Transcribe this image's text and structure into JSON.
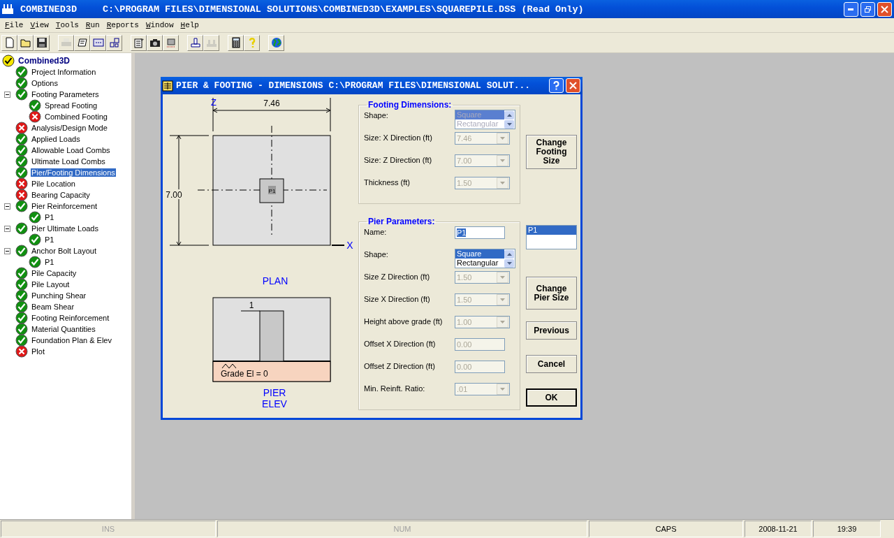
{
  "title_bar": {
    "app": "COMBINED3D",
    "document": "C:\\PROGRAM FILES\\DIMENSIONAL SOLUTIONS\\COMBINED3D\\EXAMPLES\\SQUAREPILE.DSS (Read Only)"
  },
  "menu": [
    "File",
    "View",
    "Tools",
    "Run",
    "Reports",
    "Window",
    "Help"
  ],
  "toolbar": [
    [
      {
        "kind": "page",
        "disabled": false
      },
      {
        "kind": "folder",
        "disabled": false
      },
      {
        "kind": "disk",
        "disabled": false
      }
    ],
    [
      {
        "kind": "printer",
        "disabled": true
      },
      {
        "kind": "scroll",
        "disabled": false
      },
      {
        "kind": "panel",
        "disabled": false
      },
      {
        "kind": "grid",
        "disabled": false
      }
    ],
    [
      {
        "kind": "clipboard",
        "disabled": false
      },
      {
        "kind": "camera",
        "disabled": false
      },
      {
        "kind": "chip",
        "disabled": false
      }
    ],
    [
      {
        "kind": "footing",
        "disabled": false
      },
      {
        "kind": "footings",
        "disabled": true
      }
    ],
    [
      {
        "kind": "calculator",
        "disabled": false
      },
      {
        "kind": "question",
        "disabled": false
      }
    ],
    [
      {
        "kind": "globe",
        "disabled": false
      }
    ]
  ],
  "tree": {
    "label": "Combined3D",
    "kind": "partial",
    "selected": false,
    "children": [
      {
        "label": "Project Information",
        "kind": "done",
        "selected": false
      },
      {
        "label": "Options",
        "kind": "done",
        "selected": false
      },
      {
        "label": "Footing Parameters",
        "kind": "done",
        "selected": false,
        "expanded": true,
        "children": [
          {
            "label": "Spread Footing",
            "kind": "done",
            "selected": false
          },
          {
            "label": "Combined Footing",
            "kind": "error",
            "selected": false
          }
        ]
      },
      {
        "label": "Analysis/Design Mode",
        "kind": "error",
        "selected": false
      },
      {
        "label": "Applied Loads",
        "kind": "done",
        "selected": false
      },
      {
        "label": "Allowable Load Combs",
        "kind": "done",
        "selected": false
      },
      {
        "label": "Ultimate Load Combs",
        "kind": "done",
        "selected": false
      },
      {
        "label": "Pier/Footing Dimensions",
        "kind": "done",
        "selected": true
      },
      {
        "label": "Pile Location",
        "kind": "error",
        "selected": false
      },
      {
        "label": "Bearing Capacity",
        "kind": "error",
        "selected": false
      },
      {
        "label": "Pier Reinforcement",
        "kind": "done",
        "selected": false,
        "expanded": true,
        "children": [
          {
            "label": "P1",
            "kind": "done",
            "selected": false
          }
        ]
      },
      {
        "label": "Pier Ultimate Loads",
        "kind": "done",
        "selected": false,
        "expanded": true,
        "children": [
          {
            "label": "P1",
            "kind": "done",
            "selected": false
          }
        ]
      },
      {
        "label": "Anchor Bolt Layout",
        "kind": "done",
        "selected": false,
        "expanded": true,
        "children": [
          {
            "label": "P1",
            "kind": "done",
            "selected": false
          }
        ]
      },
      {
        "label": "Pile Capacity",
        "kind": "done",
        "selected": false
      },
      {
        "label": "Pile Layout",
        "kind": "done",
        "selected": false
      },
      {
        "label": "Punching Shear",
        "kind": "done",
        "selected": false
      },
      {
        "label": "Beam Shear",
        "kind": "done",
        "selected": false
      },
      {
        "label": "Footing Reinforcement",
        "kind": "done",
        "selected": false
      },
      {
        "label": "Material Quantities",
        "kind": "done",
        "selected": false
      },
      {
        "label": "Foundation Plan & Elev",
        "kind": "done",
        "selected": false
      },
      {
        "label": "Plot",
        "kind": "error",
        "selected": false
      }
    ]
  },
  "dialog": {
    "title": "PIER & FOOTING - DIMENSIONS  C:\\PROGRAM FILES\\DIMENSIONAL SOLUT...",
    "drawing": {
      "z_axis": "Z",
      "x_axis": "X",
      "width_dim": "7.46",
      "depth_dim": "7.00",
      "pier_label": "P1",
      "plan_caption": "PLAN",
      "height_dim": "1",
      "grade_label": "Grade El = 0",
      "elev_caption": "PIER ELEV"
    },
    "groups": [
      {
        "title": "Footing Dimensions:",
        "fields": [
          {
            "label": "Shape:",
            "kind": "listbox",
            "disabled": true,
            "options": [
              {
                "text": "Square",
                "selected": true
              },
              {
                "text": "Rectangular",
                "selected": false
              }
            ]
          },
          {
            "label": "Size: X Direction (ft)",
            "kind": "combo",
            "disabled": true,
            "value": "7.46"
          },
          {
            "label": "Size: Z Direction (ft)",
            "kind": "combo",
            "disabled": true,
            "value": "7.00"
          },
          {
            "label": "Thickness (ft)",
            "kind": "combo",
            "disabled": true,
            "value": "1.50"
          }
        ]
      },
      {
        "title": "Pier Parameters:",
        "fields": [
          {
            "label": "Name:",
            "kind": "text",
            "disabled": false,
            "highlighted": true,
            "value": "P1"
          },
          {
            "label": "Shape:",
            "kind": "listbox",
            "disabled": false,
            "options": [
              {
                "text": "Square",
                "selected": true
              },
              {
                "text": "Rectangular",
                "selected": false
              }
            ]
          },
          {
            "label": "Size Z Direction (ft)",
            "kind": "combo",
            "disabled": true,
            "value": "1.50"
          },
          {
            "label": "Size X Direction (ft)",
            "kind": "combo",
            "disabled": true,
            "value": "1.50"
          },
          {
            "label": "Height above grade (ft)",
            "kind": "combo",
            "disabled": true,
            "value": "1.00"
          },
          {
            "label": "Offset X Direction (ft)",
            "kind": "text",
            "disabled": true,
            "highlighted": false,
            "value": "0.00"
          },
          {
            "label": "Offset Z Direction (ft)",
            "kind": "text",
            "disabled": true,
            "highlighted": false,
            "value": "0.00"
          },
          {
            "label": "Min.  Reinft.  Ratio:",
            "kind": "combo",
            "disabled": true,
            "value": ".01"
          }
        ]
      }
    ],
    "side": [
      {
        "kind": "button",
        "label": "Change Footing Size",
        "default": false
      },
      {
        "kind": "listbox",
        "options": [
          {
            "text": "P1",
            "selected": true
          }
        ]
      },
      {
        "kind": "button",
        "label": "Change Pier Size",
        "default": false
      },
      {
        "kind": "button",
        "label": "Previous",
        "default": false
      },
      {
        "kind": "button",
        "label": "Cancel",
        "default": false
      },
      {
        "kind": "button",
        "label": "OK",
        "default": true
      }
    ]
  },
  "status_bar": [
    {
      "text": "INS",
      "disabled": true
    },
    {
      "text": "NUM",
      "disabled": true
    },
    {
      "text": "CAPS",
      "disabled": false
    },
    {
      "text": "2008-11-21",
      "disabled": false
    },
    {
      "text": "19:39",
      "disabled": false
    }
  ]
}
